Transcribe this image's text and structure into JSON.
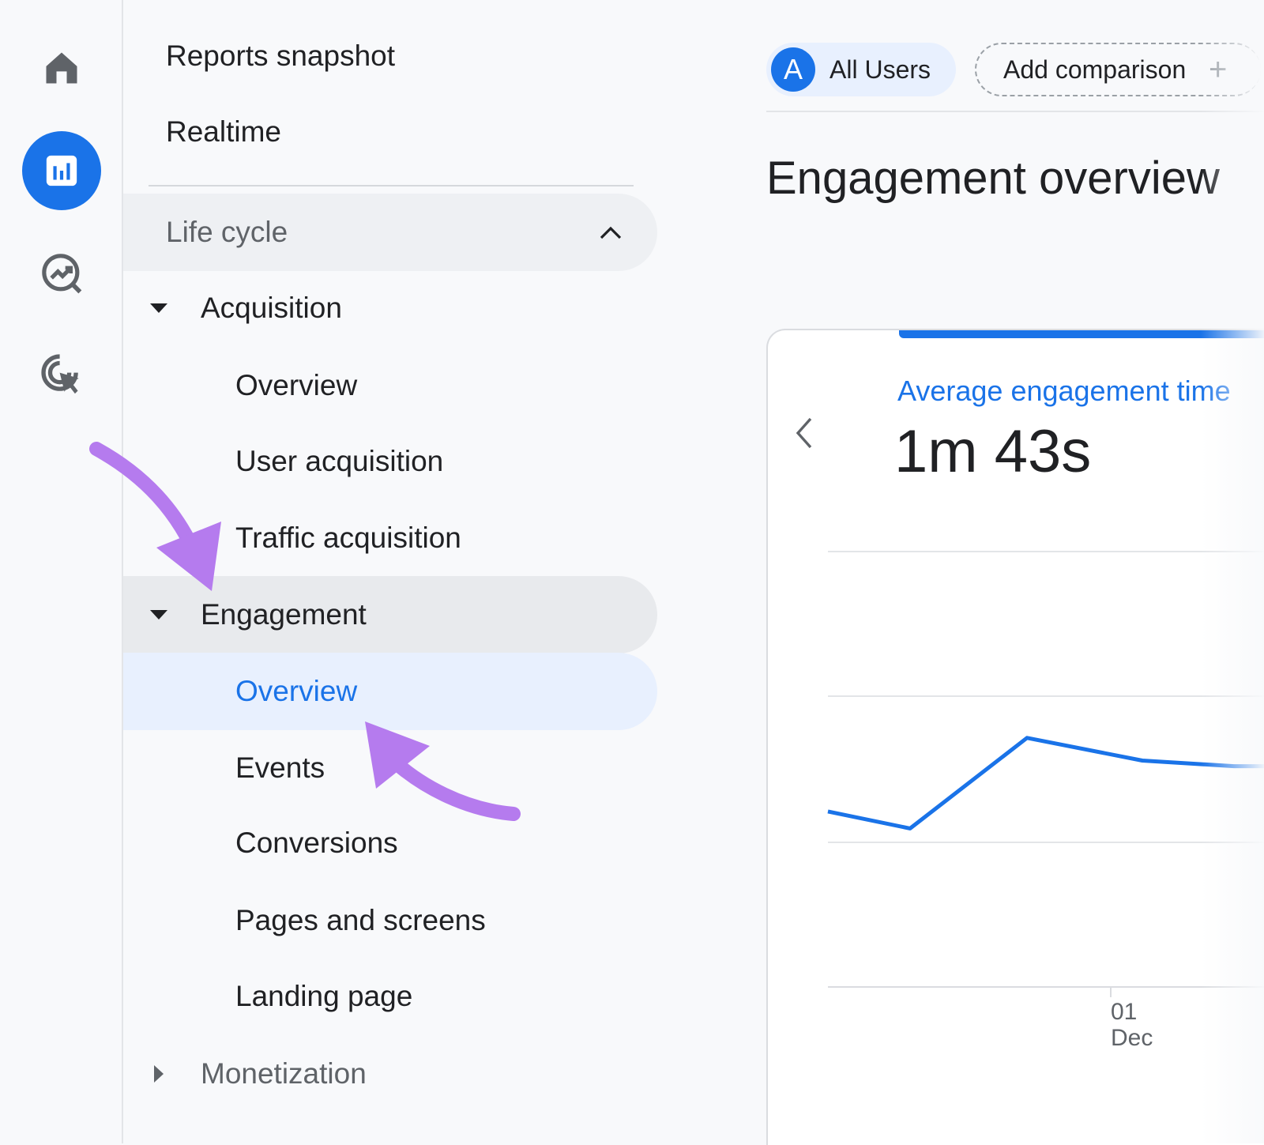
{
  "nav": {
    "reports_snapshot": "Reports snapshot",
    "realtime": "Realtime",
    "life_cycle": "Life cycle",
    "acquisition": "Acquisition",
    "acquisition_items": [
      "Overview",
      "User acquisition",
      "Traffic acquisition"
    ],
    "engagement": "Engagement",
    "engagement_items": [
      "Overview",
      "Events",
      "Conversions",
      "Pages and screens",
      "Landing page"
    ],
    "monetization": "Monetization",
    "selected": "Engagement > Overview"
  },
  "rail_icons": [
    "home-icon",
    "reports-icon",
    "explore-icon",
    "advertising-icon"
  ],
  "header": {
    "segment_avatar": "A",
    "segment_label": "All Users",
    "add_comparison": "Add comparison",
    "add_icon": "+"
  },
  "page_title": "Engagement overview",
  "metric": {
    "label": "Average engagement time",
    "value": "1m 43s"
  },
  "chart_data": {
    "type": "line",
    "x_tick_labels": [
      {
        "day": "01",
        "month": "Dec"
      }
    ],
    "series": [
      {
        "values": [
          0.62,
          0.56,
          0.88,
          0.8,
          0.78,
          0.78
        ]
      }
    ],
    "grid": true,
    "color": "#1a73e8"
  },
  "colors": {
    "accent": "#1a73e8",
    "selected_bg": "#e8f0fe",
    "annotation_arrow": "#b57bee"
  }
}
